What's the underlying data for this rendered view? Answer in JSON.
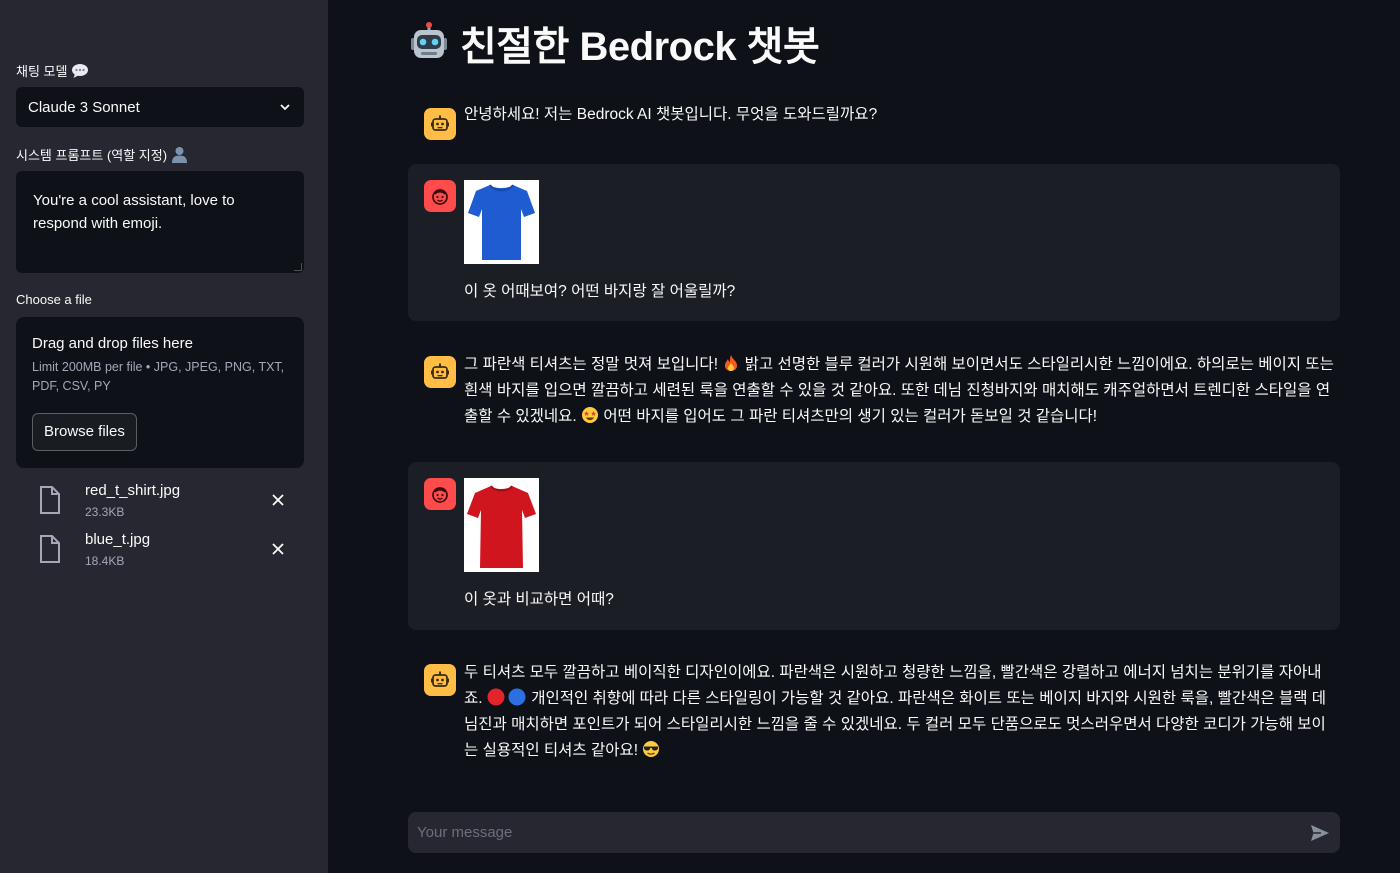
{
  "sidebar": {
    "model_label": "채팅 모델",
    "model_value": "Claude 3 Sonnet",
    "system_label": "시스템 프롬프트 (역할 지정)",
    "system_prompt": "You're a cool assistant, love to respond with emoji.",
    "file_label": "Choose a file",
    "dropzone_title": "Drag and drop files here",
    "dropzone_limit": "Limit 200MB per file • JPG, JPEG, PNG, TXT, PDF, CSV, PY",
    "browse_label": "Browse files",
    "files": [
      {
        "name": "red_t_shirt.jpg",
        "size": "23.3KB"
      },
      {
        "name": "blue_t.jpg",
        "size": "18.4KB"
      }
    ]
  },
  "main": {
    "title": "친절한 Bedrock 챗봇",
    "messages": [
      {
        "role": "assistant",
        "text": "안녕하세요! 저는 Bedrock AI 챗봇입니다. 무엇을 도와드릴까요?"
      },
      {
        "role": "user",
        "text": "이 옷 어때보여? 어떤 바지랑 잘 어울릴까?",
        "image_color": "#1f5bd1"
      },
      {
        "role": "assistant",
        "text_a": "그 파란색 티셔츠는 정말 멋져 보입니다!",
        "text_b": "밝고 선명한 블루 컬러가 시원해 보이면서도 스타일리시한 느낌이에요. 하의로는 베이지 또는 흰색 바지를 입으면 깔끔하고 세련된 룩을 연출할 수 있을 것 같아요. 또한 데님 진청바지와 매치해도 캐주얼하면서 트렌디한 스타일을 연출할 수 있겠네요.",
        "text_c": "어떤 바지를 입어도 그 파란 티셔츠만의 생기 있는 컬러가 돋보일 것 같습니다!"
      },
      {
        "role": "user",
        "text": "이 옷과 비교하면 어때?",
        "image_color": "#d0151f"
      },
      {
        "role": "assistant",
        "text_a": "두 티셔츠 모두 깔끔하고 베이직한 디자인이에요. 파란색은 시원하고 청량한 느낌을, 빨간색은 강렬하고 에너지 넘치는 분위기를 자아내죠.",
        "text_b": "개인적인 취향에 따라 다른 스타일링이 가능할 것 같아요. 파란색은 화이트 또는 베이지 바지와 시원한 룩을, 빨간색은 블랙 데님진과 매치하면 포인트가 되어 스타일리시한 느낌을 줄 수 있겠네요. 두 컬러 모두 단품으로도 멋스러우면서 다양한 코디가 가능해 보이는 실용적인 티셔츠 같아요!"
      }
    ],
    "input_placeholder": "Your message"
  },
  "colors": {
    "bg": "#0e1117",
    "sidebar": "#262730",
    "bot_avatar": "#ffbd45",
    "user_avatar": "#ff4b4b"
  }
}
